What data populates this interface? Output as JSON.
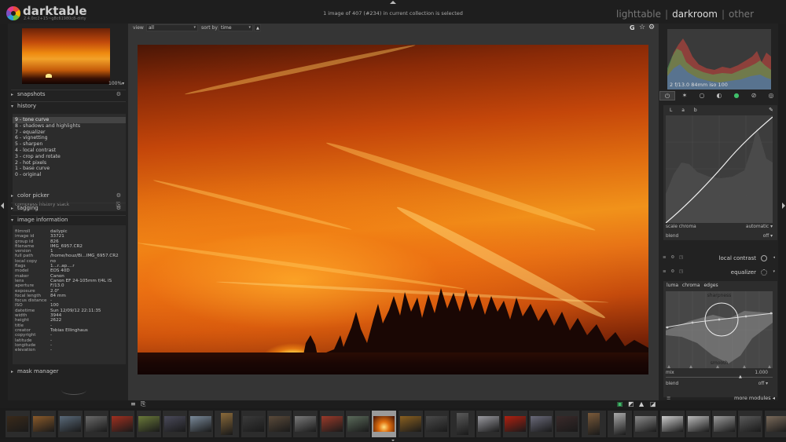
{
  "header": {
    "app_name": "darktable",
    "version": "2.4.0rc2+15~g8c61980c8-dirty",
    "collection_info": "1 image of 407 (#234) in current collection is selected",
    "views": [
      "lighttable",
      "darkroom",
      "other"
    ],
    "active_view": "darkroom"
  },
  "left_panel": {
    "zoom": "100%",
    "sections": {
      "snapshots": "snapshots",
      "history": "history",
      "color_picker": "color picker",
      "tagging": "tagging",
      "image_information": "image information",
      "mask_manager": "mask manager"
    },
    "history_items": [
      "9 - tone curve",
      "8 - shadows and highlights",
      "7 - equalizer",
      "6 - vignetting",
      "5 - sharpen",
      "4 - local contrast",
      "3 - crop and rotate",
      "2 - hot pixels",
      "1 - base curve",
      "0 - original"
    ],
    "history_selected": 0,
    "compress_label": "compress history stack",
    "image_info": [
      {
        "key": "filmroll",
        "value": "dailypic"
      },
      {
        "key": "image id",
        "value": "33721"
      },
      {
        "key": "group id",
        "value": "826"
      },
      {
        "key": "filename",
        "value": "IMG_6957.CR2"
      },
      {
        "key": "version",
        "value": "1"
      },
      {
        "key": "full path",
        "value": "/home/houz/Bi...IMG_6957.CR2"
      },
      {
        "key": "local copy",
        "value": "no"
      },
      {
        "key": "flags",
        "value": "1...r..ap....r"
      },
      {
        "key": "model",
        "value": "EOS 40D"
      },
      {
        "key": "maker",
        "value": "Canon"
      },
      {
        "key": "lens",
        "value": "Canon EF 24-105mm f/4L IS"
      },
      {
        "key": "aperture",
        "value": "F/13.0"
      },
      {
        "key": "exposure",
        "value": "2.0\""
      },
      {
        "key": "focal length",
        "value": "84 mm"
      },
      {
        "key": "focus distance",
        "value": "-"
      },
      {
        "key": "ISO",
        "value": "100"
      },
      {
        "key": "datetime",
        "value": "Sun 12/09/12 22:11:35"
      },
      {
        "key": "width",
        "value": "3944"
      },
      {
        "key": "height",
        "value": "2622"
      },
      {
        "key": "title",
        "value": "-"
      },
      {
        "key": "creator",
        "value": "Tobias Ellinghaus"
      },
      {
        "key": "copyright",
        "value": "-"
      },
      {
        "key": "latitude",
        "value": "-"
      },
      {
        "key": "longitude",
        "value": "-"
      },
      {
        "key": "elevation",
        "value": "-"
      }
    ]
  },
  "center_toolbar": {
    "view_label": "view",
    "view_value": "all",
    "sort_label": "sort by",
    "sort_value": "time"
  },
  "right_panel": {
    "histogram_exif": "2   f/13.0 84mm iso 100",
    "tone_curve": {
      "tabs": [
        "L",
        "a",
        "b"
      ],
      "scale_chroma_label": "scale chroma",
      "scale_chroma_value": "automatic",
      "blend_label": "blend",
      "blend_value": "off"
    },
    "local_contrast_label": "local contrast",
    "equalizer": {
      "name": "equalizer",
      "tabs": [
        "luma",
        "chroma",
        "edges"
      ],
      "top_label": "sharpness",
      "bottom_label": "smooth",
      "mix_label": "mix",
      "mix_value": "1.000",
      "blend_label": "blend",
      "blend_value": "off"
    },
    "more_modules": "more modules"
  },
  "colors": {
    "background": "#1d1d1d",
    "panel": "#222222",
    "center": "#353535",
    "accent_green": "#3fbf6a"
  }
}
